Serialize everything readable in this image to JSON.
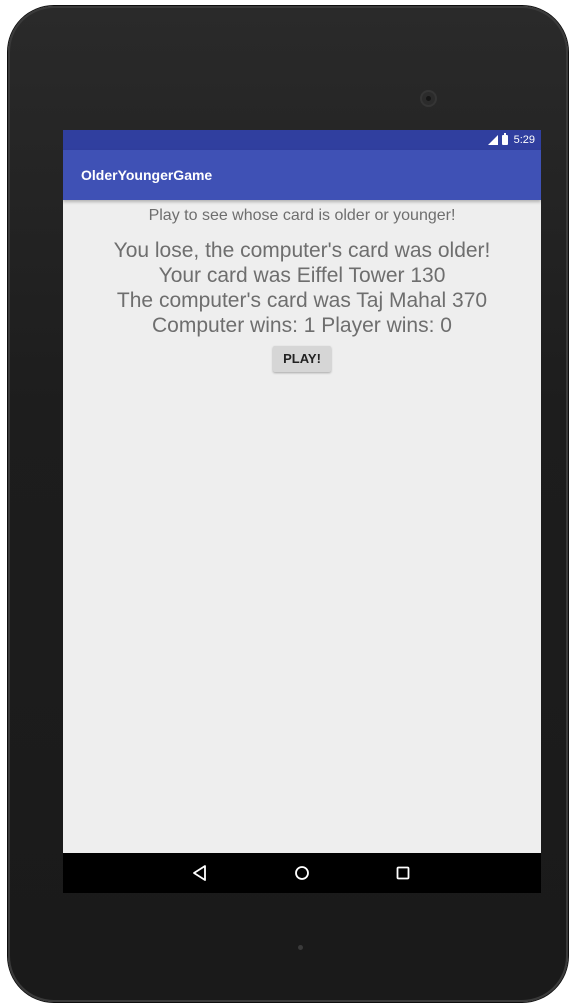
{
  "status_bar": {
    "time": "5:29",
    "icons": [
      "signal-icon",
      "battery-icon"
    ]
  },
  "app_bar": {
    "title": "OlderYoungerGame"
  },
  "main": {
    "prompt": "Play to see whose card is older or younger!",
    "result_lines": [
      "You lose, the computer's card was older!",
      "Your card was Eiffel Tower 130",
      "The computer's card was Taj Mahal 370",
      "Computer wins: 1 Player wins: 0"
    ],
    "play_button_label": "PLAY!"
  },
  "nav_bar": {
    "icons": [
      "back-icon",
      "home-icon",
      "recents-icon"
    ]
  },
  "colors": {
    "status_bar": "#303f9f",
    "app_bar": "#3f51b5",
    "background": "#eeeeee",
    "text": "#6e6e6e"
  }
}
